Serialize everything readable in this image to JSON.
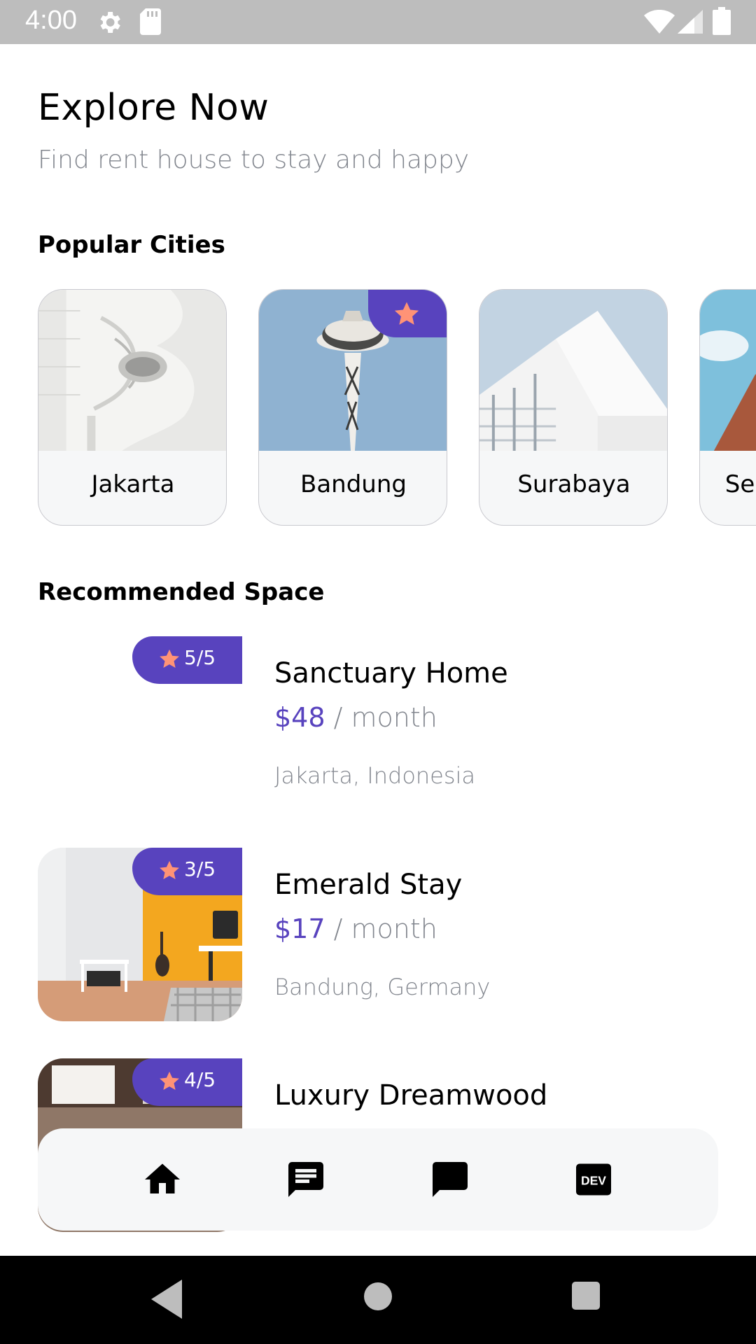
{
  "status_bar": {
    "time": "4:00"
  },
  "header": {
    "title": "Explore Now",
    "subtitle": "Find rent house to stay and happy"
  },
  "popular": {
    "title": "Popular Cities",
    "cities": [
      {
        "name": "Jakarta",
        "popular": false
      },
      {
        "name": "Bandung",
        "popular": true
      },
      {
        "name": "Surabaya",
        "popular": false
      },
      {
        "name": "Se",
        "popular": false
      }
    ]
  },
  "recommended": {
    "title": "Recommended Space",
    "items": [
      {
        "rating": "5/5",
        "name": "Sanctuary Home",
        "price": "$48",
        "unit": " / month",
        "location": "Jakarta, Indonesia"
      },
      {
        "rating": "3/5",
        "name": "Emerald Stay",
        "price": "$17",
        "unit": " / month",
        "location": "Bandung, Germany"
      },
      {
        "rating": "4/5",
        "name": "Luxury Dreamwood",
        "price": "",
        "unit": "",
        "location": ""
      }
    ]
  },
  "bottom_nav": {
    "items": [
      {
        "icon": "home-icon"
      },
      {
        "icon": "message-icon"
      },
      {
        "icon": "chat-icon"
      },
      {
        "icon": "dev-icon",
        "label": "DEV"
      }
    ]
  },
  "colors": {
    "accent": "#5843be",
    "star": "#ff9376",
    "muted": "#82868e",
    "card_bg": "#f6f7f8"
  }
}
